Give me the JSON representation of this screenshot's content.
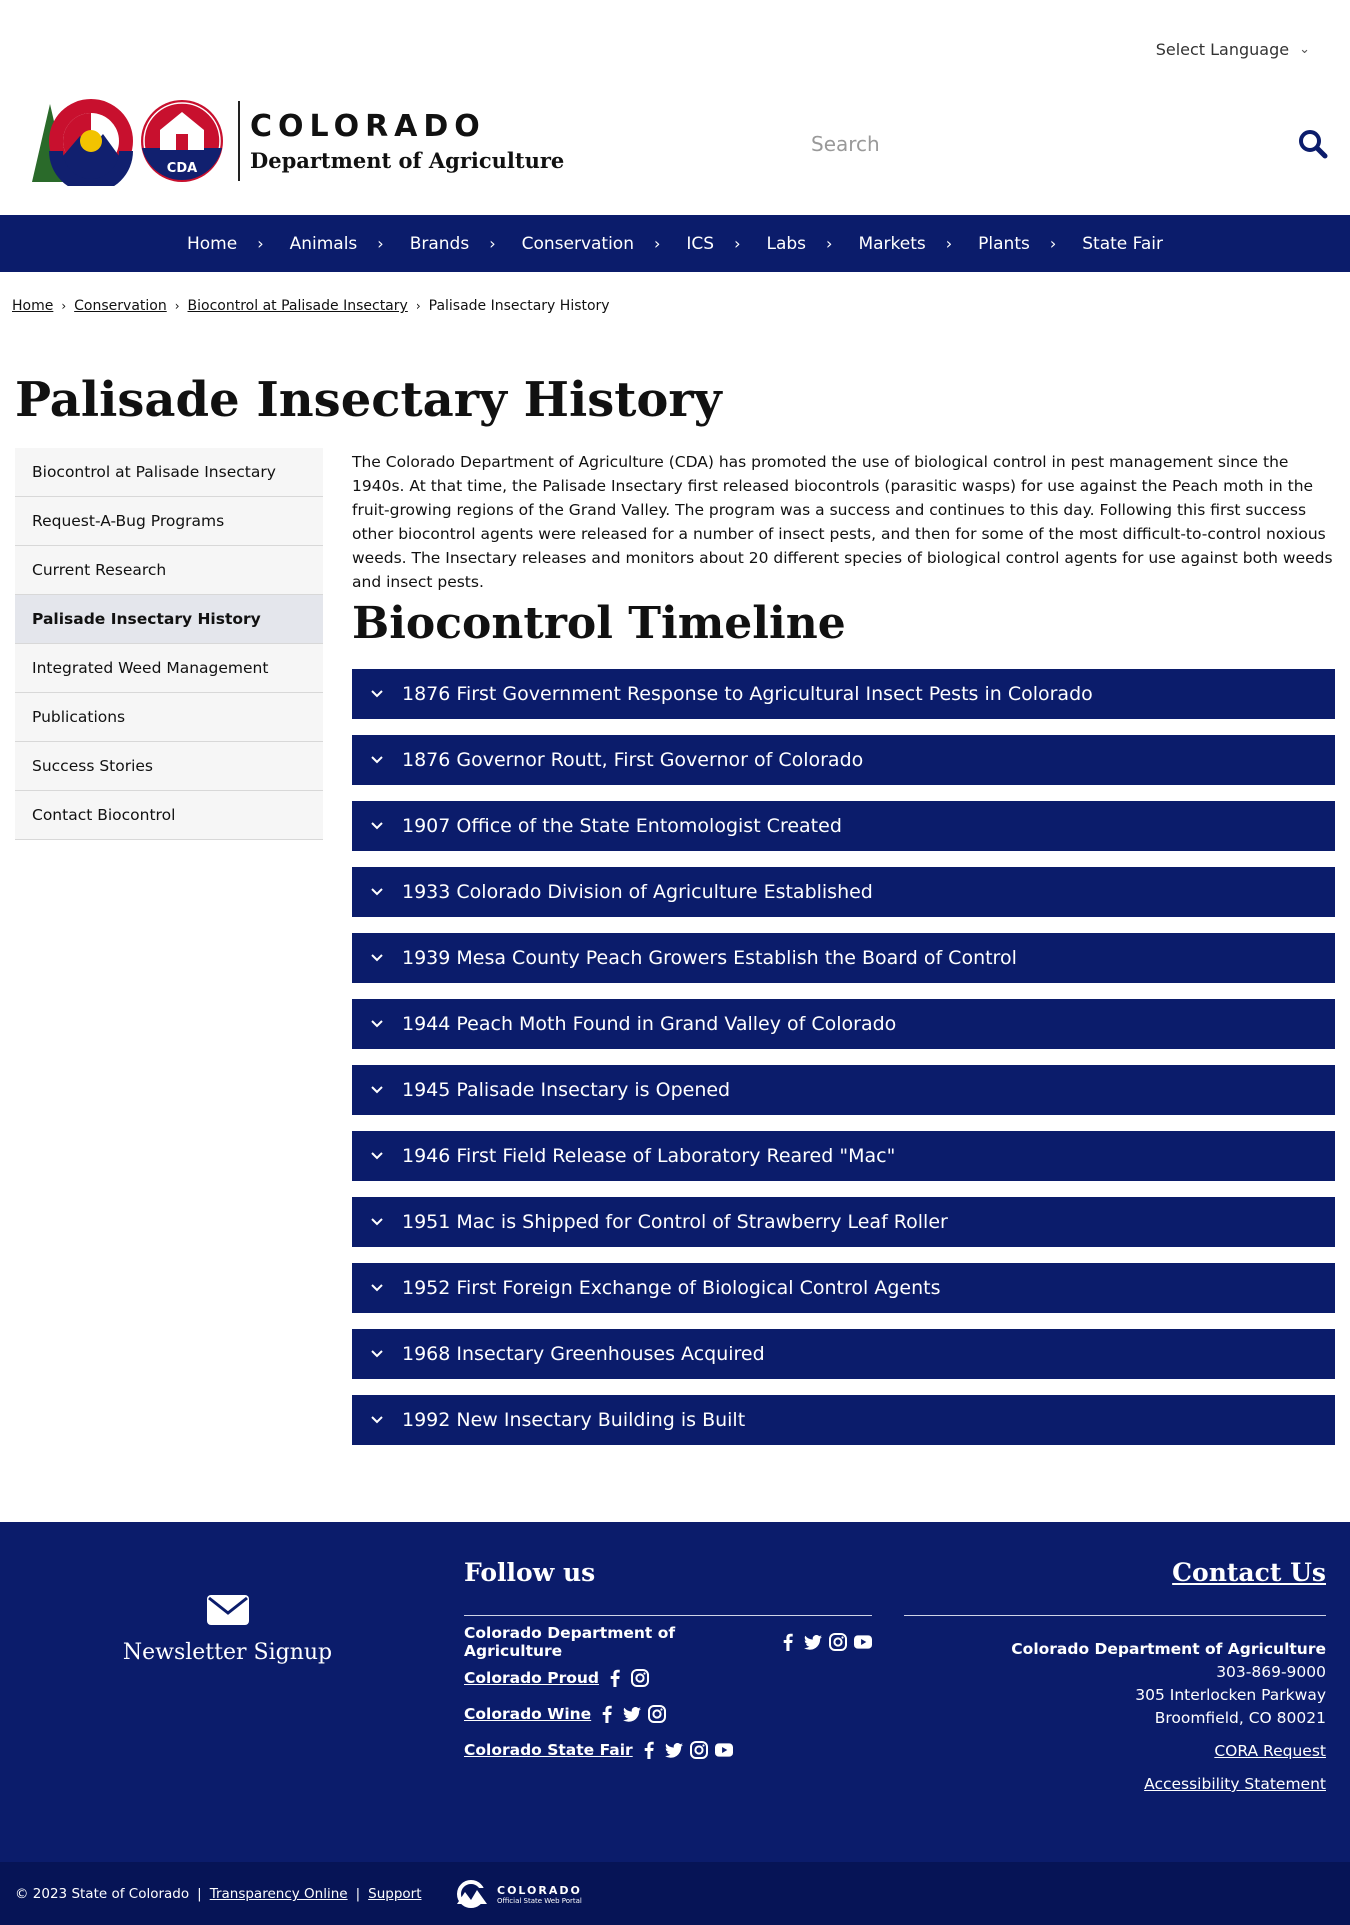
{
  "language": {
    "label": "Select Language"
  },
  "header": {
    "org_line1": "COLORADO",
    "org_line2": "Department of Agriculture",
    "seal_text": "CDA",
    "search_placeholder": "Search"
  },
  "nav": {
    "items": [
      "Home",
      "Animals",
      "Brands",
      "Conservation",
      "ICS",
      "Labs",
      "Markets",
      "Plants",
      "State Fair"
    ]
  },
  "breadcrumb": {
    "links": [
      "Home",
      "Conservation",
      "Biocontrol at Palisade Insectary"
    ],
    "current": "Palisade Insectary History"
  },
  "page_title": "Palisade Insectary History",
  "sidebar": {
    "items": [
      "Biocontrol at Palisade Insectary",
      "Request-A-Bug Programs",
      "Current Research",
      "Palisade Insectary History",
      "Integrated Weed Management",
      "Publications",
      "Success Stories",
      "Contact Biocontrol"
    ],
    "active_index": 3
  },
  "intro": "The Colorado Department of Agriculture (CDA) has promoted the use of biological control in pest management since the 1940s. At that time, the Palisade Insectary first released biocontrols (parasitic wasps) for use against the Peach moth in the fruit-growing regions of the Grand Valley. The program was a success and continues to this day. Following this first success other biocontrol agents were released for a number of insect pests, and then for some of the most difficult-to-control noxious weeds. The Insectary releases and monitors about 20 different species of biological control agents for use against both weeds and insect pests.",
  "timeline": {
    "heading": "Biocontrol Timeline",
    "items": [
      "1876 First Government Response to Agricultural Insect Pests in Colorado",
      "1876 Governor Routt, First Governor of Colorado",
      "1907 Office of the State Entomologist Created",
      "1933 Colorado Division of Agriculture Established",
      "1939 Mesa County Peach Growers Establish the Board of Control",
      "1944 Peach Moth Found in Grand Valley of Colorado",
      "1945 Palisade Insectary is Opened",
      "1946 First Field Release of Laboratory Reared \"Mac\"",
      "1951 Mac is Shipped for Control of Strawberry Leaf Roller",
      "1952 First Foreign Exchange of Biological Control Agents",
      "1968 Insectary Greenhouses Acquired",
      "1992 New Insectary Building is Built"
    ]
  },
  "footer": {
    "newsletter": "Newsletter Signup",
    "follow_heading": "Follow us",
    "follow_rows": [
      {
        "name": "Colorado Department of Agriculture",
        "icons": [
          "facebook-icon",
          "twitter-icon",
          "instagram-icon",
          "youtube-icon"
        ]
      },
      {
        "name": "Colorado Proud",
        "icons": [
          "facebook-icon",
          "instagram-icon"
        ]
      },
      {
        "name": "Colorado Wine",
        "icons": [
          "facebook-icon",
          "twitter-icon",
          "instagram-icon"
        ]
      },
      {
        "name": "Colorado State Fair",
        "icons": [
          "facebook-icon",
          "twitter-icon",
          "instagram-icon",
          "youtube-icon"
        ]
      }
    ],
    "contact_heading": "Contact Us",
    "contact_org": "Colorado Department of Agriculture",
    "phone": "303-869-9000",
    "address1": "305 Interlocken Parkway",
    "address2": "Broomfield, CO 80021",
    "cora": "CORA Request",
    "accessibility": "Accessibility Statement",
    "copyright": "© 2023 State of Colorado",
    "transparency": "Transparency Online",
    "support": "Support",
    "portal_line1": "COLORADO",
    "portal_line2": "Official State Web Portal"
  },
  "colors": {
    "navy": "#0b1c6b",
    "dark_navy": "#061456",
    "sidebar_bg": "#f6f6f6",
    "sidebar_active": "#e4e6ec"
  }
}
